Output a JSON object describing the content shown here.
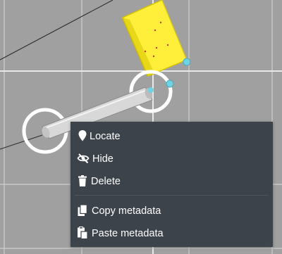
{
  "viewport": {
    "background_color": "#a0a0a0",
    "grid_color": "#cfcfcf",
    "axis_color": "#f2f2f2"
  },
  "objects": [
    {
      "name": "yellow-box",
      "color": "#ffef3a"
    },
    {
      "name": "gray-rod",
      "color": "#d8d8d8"
    }
  ],
  "selection": {
    "handle_color": "#ffffff",
    "pivot_color": "#6fd3e3"
  },
  "context_menu": {
    "background": "#3c434a",
    "items": [
      {
        "label": "Locate",
        "icon": "map-pin-icon"
      },
      {
        "label": "Hide",
        "icon": "eye-slash-icon"
      },
      {
        "label": "Delete",
        "icon": "trash-icon"
      },
      {
        "label": "Copy metadata",
        "icon": "copy-icon"
      },
      {
        "label": "Paste metadata",
        "icon": "paste-icon"
      }
    ]
  }
}
